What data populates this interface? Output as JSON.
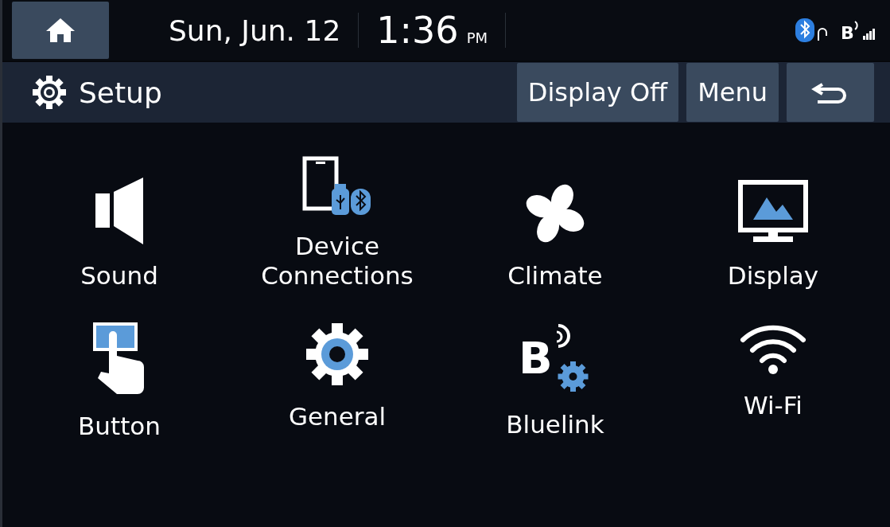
{
  "status_bar": {
    "date": "Sun, Jun. 12",
    "time": "1:36",
    "meridiem": "PM",
    "bluelink_glyph": "B"
  },
  "header": {
    "title": "Setup",
    "buttons": [
      {
        "label": "Display Off",
        "kind": "text"
      },
      {
        "label": "Menu",
        "kind": "text"
      },
      {
        "kind": "back"
      }
    ]
  },
  "items": [
    {
      "label": "Sound",
      "kind": "sound"
    },
    {
      "label": "Device\nConnections",
      "kind": "devices"
    },
    {
      "label": "Climate",
      "kind": "climate"
    },
    {
      "label": "Display",
      "kind": "display"
    },
    {
      "label": "Button",
      "kind": "button"
    },
    {
      "label": "General",
      "kind": "general"
    },
    {
      "label": "Bluelink",
      "kind": "bluelink",
      "glyph": "B"
    },
    {
      "label": "Wi-Fi",
      "kind": "wifi"
    }
  ]
}
